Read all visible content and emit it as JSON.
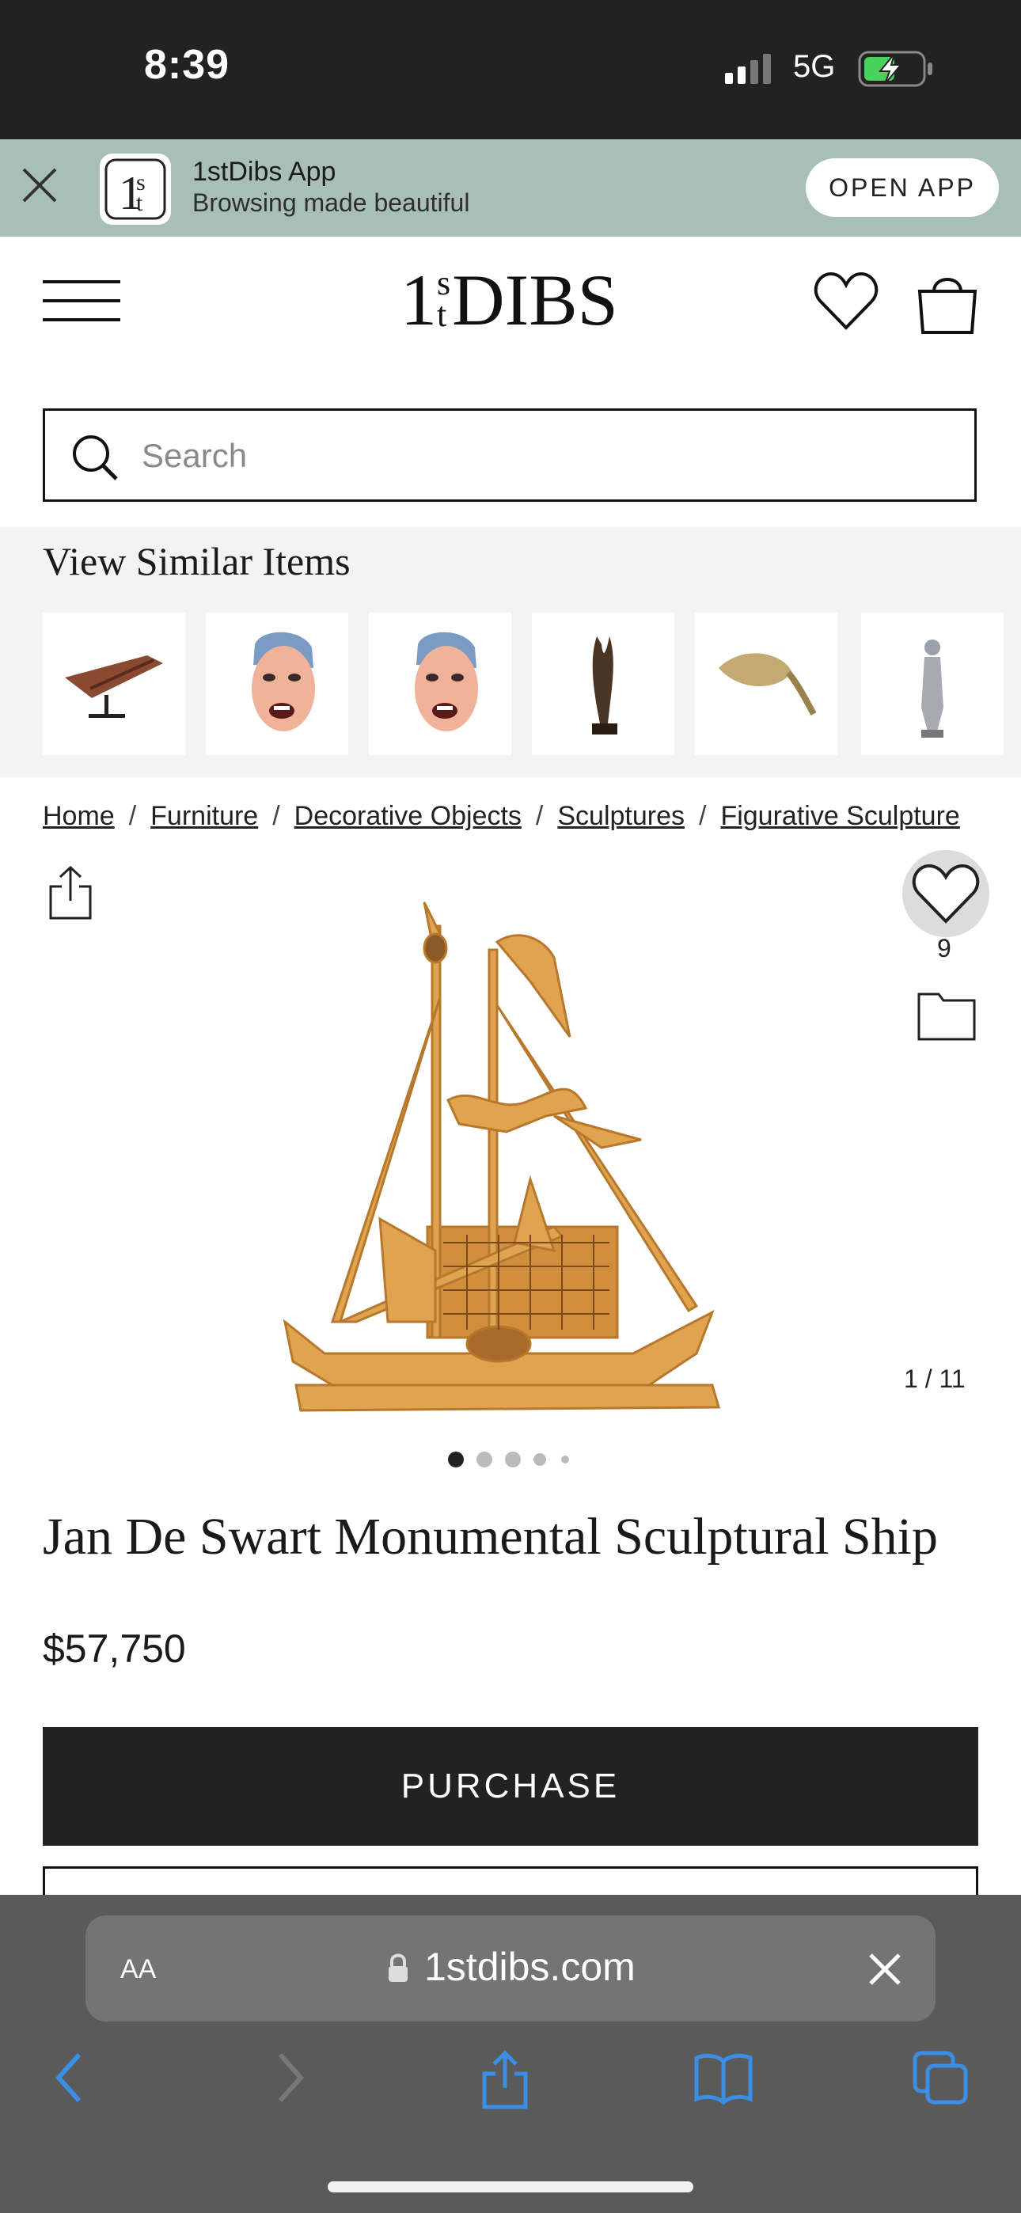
{
  "status_bar": {
    "time": "8:39",
    "network": "5G"
  },
  "app_banner": {
    "app_name": "1stDibs App",
    "tagline": "Browsing made beautiful",
    "open_label": "OPEN APP"
  },
  "header": {
    "logo_main": "DIBS",
    "logo_super": "s",
    "logo_sub": "t",
    "logo_one": "1"
  },
  "search": {
    "placeholder": "Search"
  },
  "similar": {
    "title": "View Similar Items",
    "items": [
      "carved wood sculpture",
      "face mask",
      "face mask",
      "bronze hand sculpture",
      "brass shell sculpture",
      "figurine"
    ]
  },
  "breadcrumb": [
    "Home",
    "Furniture",
    "Decorative Objects",
    "Sculptures",
    "Figurative Sculpture"
  ],
  "product": {
    "favorites_count": "9",
    "image_counter": "1 / 11",
    "title": "Jan De Swart Monumental Sculptural Ship",
    "price": "$57,750",
    "purchase_label": "PURCHASE"
  },
  "safari": {
    "aa_label": "AA",
    "domain": "1stdibs.com"
  },
  "colors": {
    "banner": "#a8bfb7",
    "dark": "#222222",
    "safari_bar": "#5a5a5a",
    "link_blue": "#3a8ee6"
  }
}
